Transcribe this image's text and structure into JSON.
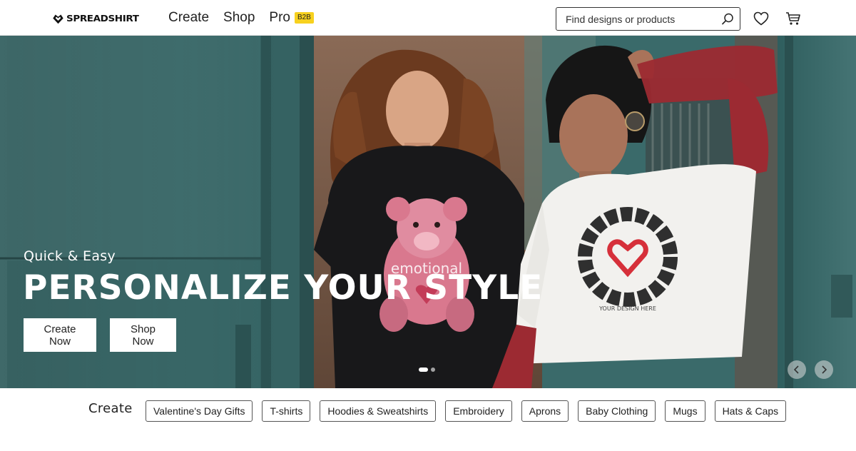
{
  "header": {
    "logo_text": "SPREADSHIRT",
    "nav": {
      "create": "Create",
      "shop": "Shop",
      "pro": "Pro",
      "pro_badge": "B2B"
    },
    "search": {
      "placeholder": "Find designs or products",
      "icon": "search-icon"
    },
    "wishlist_icon": "heart-icon",
    "cart_icon": "cart-icon"
  },
  "hero": {
    "eyebrow": "Quick & Easy",
    "title": "PERSONALIZE YOUR STYLE",
    "create_button": "Create Now",
    "shop_button": "Shop Now",
    "slides_total": 2,
    "active_slide": 1,
    "prev_icon": "chevron-left-icon",
    "next_icon": "chevron-right-icon",
    "image": {
      "shirt_print_left": "emotional",
      "shirt_print_right_ring": "YOUR DESIGN HERE"
    }
  },
  "categories": {
    "label": "Create",
    "items": [
      "Valentine's Day Gifts",
      "T-shirts",
      "Hoodies & Sweatshirts",
      "Embroidery",
      "Aprons",
      "Baby Clothing",
      "Mugs",
      "Hats & Caps"
    ]
  },
  "colors": {
    "teal": "#3c6c6c",
    "badge_yellow": "#f7d11e",
    "brick": "#7a5a47",
    "lace_red": "#9c2a32",
    "heart_red": "#d6303a"
  }
}
